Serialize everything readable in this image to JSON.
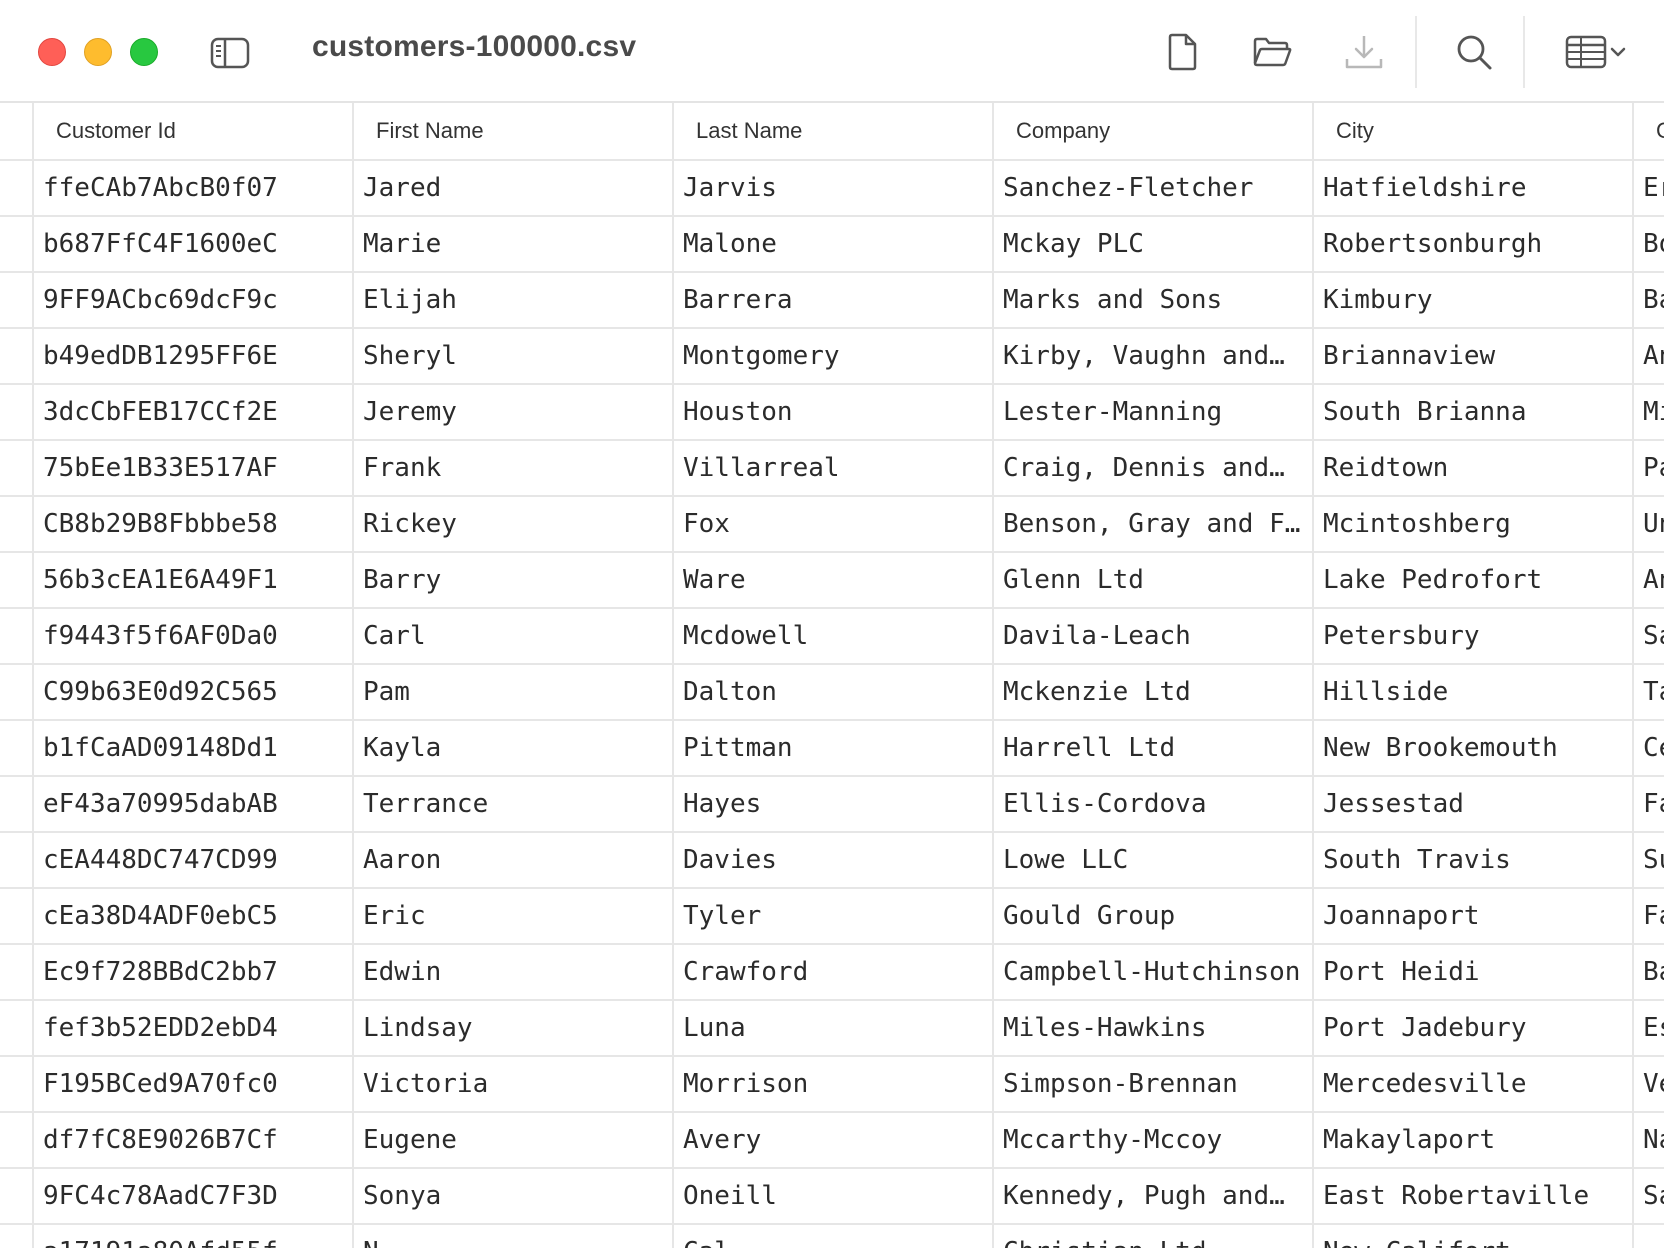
{
  "window": {
    "title": "customers-100000.csv"
  },
  "toolbar": {
    "icons": [
      "sidebar-icon",
      "new-file-icon",
      "open-folder-icon",
      "download-icon",
      "search-icon",
      "table-view-icon",
      "chevron-down-icon"
    ]
  },
  "colors": {
    "close": "#ff5f57",
    "minimize": "#febc2e",
    "maximize": "#28c840",
    "grid_line": "#e6e6e6"
  },
  "table": {
    "columns": [
      "Customer Id",
      "First Name",
      "Last Name",
      "Company",
      "City",
      "C"
    ],
    "rows": [
      [
        "ffeCAb7AbcB0f07",
        "Jared",
        "Jarvis",
        "Sanchez-Fletcher",
        "Hatfieldshire",
        "Er"
      ],
      [
        "b687FfC4F1600eC",
        "Marie",
        "Malone",
        "Mckay PLC",
        "Robertsonburgh",
        "Bo"
      ],
      [
        "9FF9ACbc69dcF9c",
        "Elijah",
        "Barrera",
        "Marks and Sons",
        "Kimbury",
        "Ba"
      ],
      [
        "b49edDB1295FF6E",
        "Sheryl",
        "Montgomery",
        "Kirby, Vaughn and…",
        "Briannaview",
        "An"
      ],
      [
        "3dcCbFEB17CCf2E",
        "Jeremy",
        "Houston",
        "Lester-Manning",
        "South Brianna",
        "Mi"
      ],
      [
        "75bEe1B33E517AF",
        "Frank",
        "Villarreal",
        "Craig, Dennis and…",
        "Reidtown",
        "Pa"
      ],
      [
        "CB8b29B8Fbbbe58",
        "Rickey",
        "Fox",
        "Benson, Gray and F…",
        "Mcintoshberg",
        "Un"
      ],
      [
        "56b3cEA1E6A49F1",
        "Barry",
        "Ware",
        "Glenn Ltd",
        "Lake Pedrofort",
        "An"
      ],
      [
        "f9443f5f6AF0Da0",
        "Carl",
        "Mcdowell",
        "Davila-Leach",
        "Petersbury",
        "Sa"
      ],
      [
        "C99b63E0d92C565",
        "Pam",
        "Dalton",
        "Mckenzie Ltd",
        "Hillside",
        "Ta"
      ],
      [
        "b1fCaAD09148Dd1",
        "Kayla",
        "Pittman",
        "Harrell Ltd",
        "New Brookemouth",
        "Ce"
      ],
      [
        "eF43a70995dabAB",
        "Terrance",
        "Hayes",
        "Ellis-Cordova",
        "Jessestad",
        "Fa"
      ],
      [
        "cEA448DC747CD99",
        "Aaron",
        "Davies",
        "Lowe LLC",
        "South Travis",
        "Su"
      ],
      [
        "cEa38D4ADF0ebC5",
        "Eric",
        "Tyler",
        "Gould Group",
        "Joannaport",
        "Fa"
      ],
      [
        "Ec9f728BBdC2bb7",
        "Edwin",
        "Crawford",
        "Campbell-Hutchinson",
        "Port Heidi",
        "Ba"
      ],
      [
        "fef3b52EDD2ebD4",
        "Lindsay",
        "Luna",
        "Miles-Hawkins",
        "Port Jadebury",
        "Es"
      ],
      [
        "F195BCed9A70fc0",
        "Victoria",
        "Morrison",
        "Simpson-Brennan",
        "Mercedesville",
        "Ve"
      ],
      [
        "df7fC8E9026B7Cf",
        "Eugene",
        "Avery",
        "Mccarthy-Mccoy",
        "Makaylaport",
        "Na"
      ],
      [
        "9FC4c78AadC7F3D",
        "Sonya",
        "Oneill",
        "Kennedy, Pugh and…",
        "East Robertaville",
        "Sa"
      ],
      [
        "a17191a80Afd55f",
        "N",
        "Cal",
        "Christian Ltd",
        "New Califort",
        ""
      ]
    ]
  }
}
